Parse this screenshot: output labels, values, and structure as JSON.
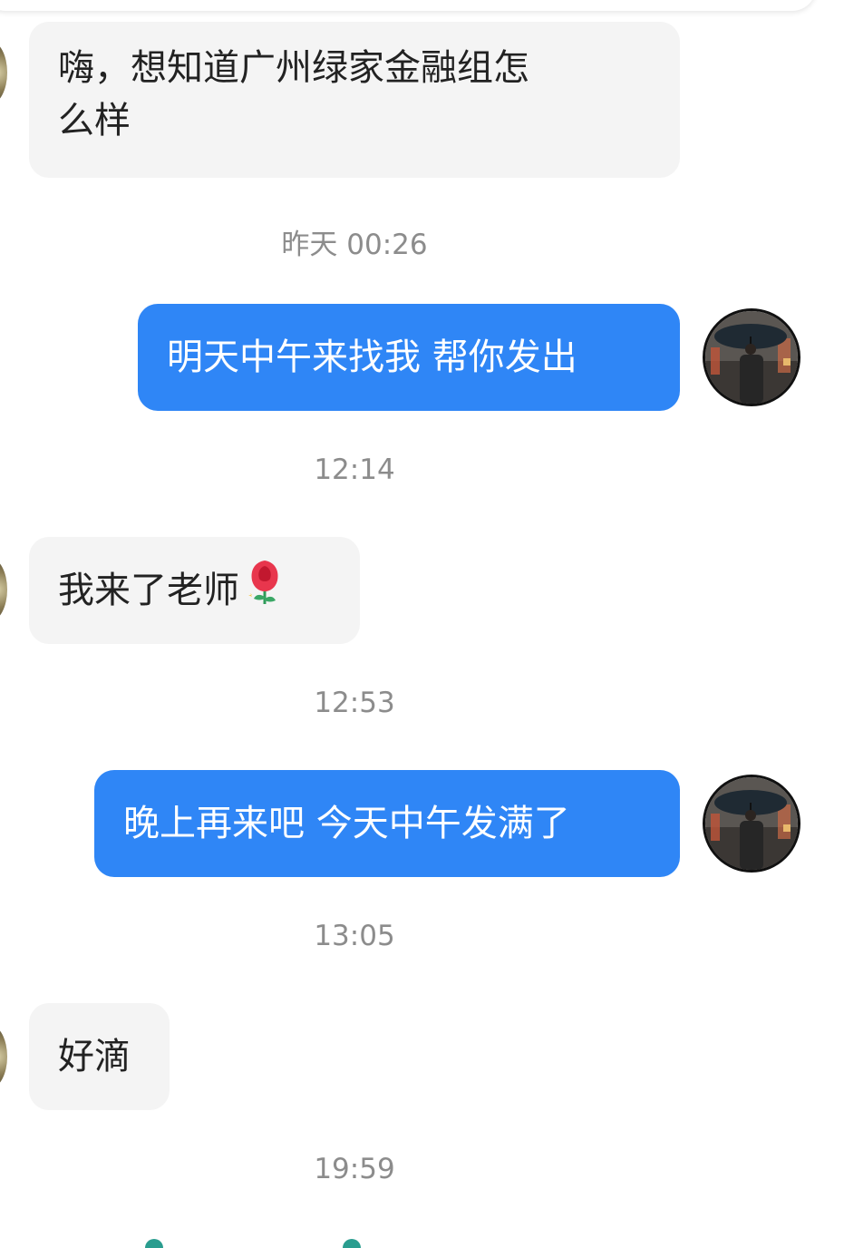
{
  "messages": [
    {
      "direction": "incoming",
      "text": "嗨，想知道广州绿家金融组怎么样",
      "line1": "嗨，想知道广州绿家金融组怎",
      "line2": "么样"
    },
    {
      "direction": "time",
      "text": "昨天 00:26"
    },
    {
      "direction": "outgoing",
      "text": "明天中午来找我 帮你发出"
    },
    {
      "direction": "time",
      "text": "12:14"
    },
    {
      "direction": "incoming",
      "text": "我来了老师",
      "emoji": "rose-emoji"
    },
    {
      "direction": "time",
      "text": "12:53"
    },
    {
      "direction": "outgoing",
      "text": "晚上再来吧 今天中午发满了"
    },
    {
      "direction": "time",
      "text": "13:05"
    },
    {
      "direction": "incoming",
      "text": "好滴"
    },
    {
      "direction": "time",
      "text": "19:59"
    }
  ],
  "colors": {
    "outgoing_bubble": "#2f86f6",
    "incoming_bubble": "#f4f4f4",
    "timestamp_text": "#8c8c8c"
  },
  "icons": {
    "sender_avatar": "man-with-umbrella-avatar",
    "contact_avatar": "contact-avatar",
    "emoji": "rose-emoji"
  }
}
